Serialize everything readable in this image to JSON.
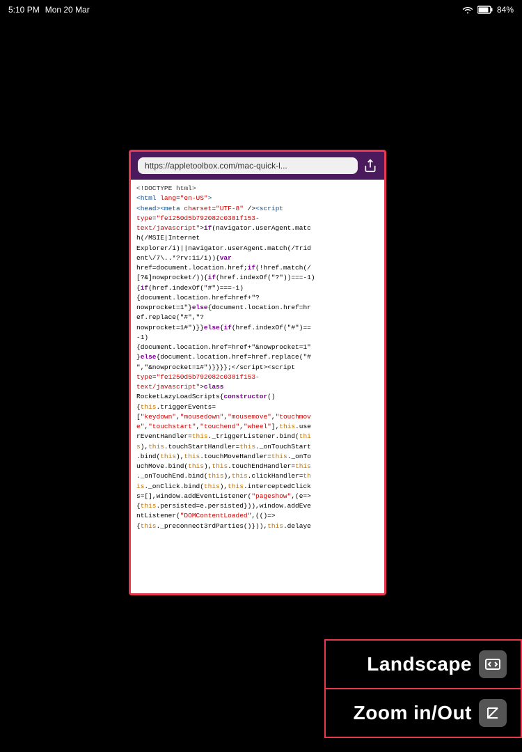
{
  "statusBar": {
    "time": "5:10 PM",
    "date": "Mon 20 Mar",
    "battery": "84%"
  },
  "browser": {
    "url": "https://appletoolbox.com/mac-quick-l...",
    "shareLabel": "share"
  },
  "codeLines": [
    {
      "type": "doctype",
      "text": "<!DOCTYPE html>"
    },
    {
      "type": "tag",
      "text": "<html lang=\"en-US\">"
    },
    {
      "type": "mixed"
    },
    {
      "type": "mixed2"
    },
    {
      "type": "mixed3"
    }
  ],
  "buttons": {
    "landscape": {
      "label": "Landscape",
      "icon": "rotate"
    },
    "zoom": {
      "label": "Zoom in/Out",
      "icon": "zoom"
    }
  }
}
